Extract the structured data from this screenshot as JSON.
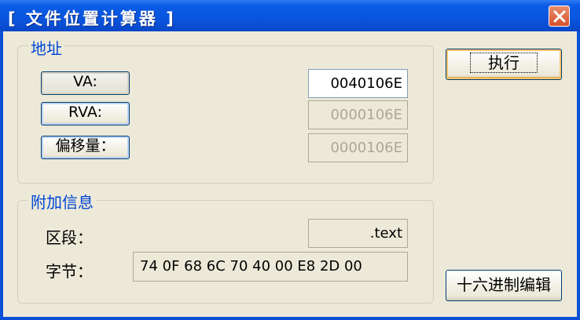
{
  "window": {
    "title": "[ 文件位置计算器 ]"
  },
  "address_group": {
    "label": "地址",
    "va_button": "VA:",
    "rva_button": "RVA:",
    "offset_button": "偏移量：",
    "va_value": "0040106E",
    "rva_value": "0000106E",
    "offset_value": "0000106E"
  },
  "info_group": {
    "label": "附加信息",
    "section_label": "区段：",
    "section_value": ".text",
    "bytes_label": "字节：",
    "bytes_value": "74 0F 68 6C 70 40 00 E8 2D 00"
  },
  "actions": {
    "execute": "执行",
    "hex_edit": "十六进制编辑"
  },
  "colors": {
    "titlebar": "#0a55de",
    "client_bg": "#ece9d8",
    "group_label": "#0046d5",
    "close_button": "#d6502a"
  }
}
